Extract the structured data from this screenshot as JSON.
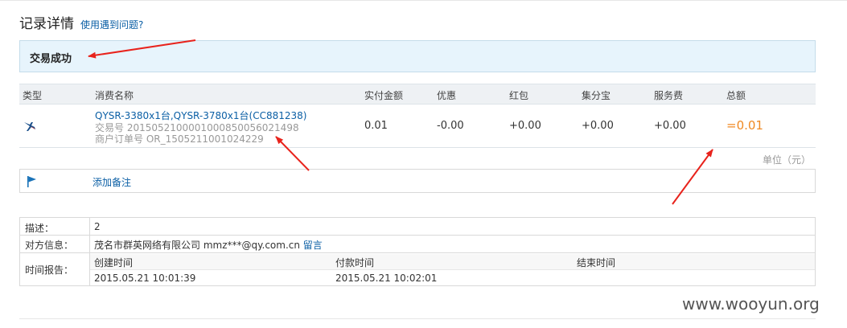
{
  "header": {
    "title": "记录详情",
    "help_link": "使用遇到问题?"
  },
  "status": {
    "text": "交易成功"
  },
  "table": {
    "columns": [
      "类型",
      "消费名称",
      "实付金额",
      "优惠",
      "红包",
      "集分宝",
      "服务费",
      "总额"
    ],
    "row": {
      "type_icon": "bird-icon",
      "name": "QYSR-3380x1台,QYSR-3780x1台(CC881238)",
      "trade_no": "交易号 2015052100001000850056021498",
      "order_no": "商户订单号 OR_1505211001024229",
      "paid": "0.01",
      "discount": "-0.00",
      "red_packet": "+0.00",
      "jifenbao": "+0.00",
      "service_fee": "+0.00",
      "total": "=0.01"
    },
    "unit": "单位（元）"
  },
  "note": {
    "icon": "flag-icon",
    "label": "添加备注"
  },
  "info": {
    "desc_label": "描述：",
    "desc_value": "2",
    "party_label": "对方信息：",
    "party_name": "茂名市群英网络有限公司 mmz***@qy.com.cn",
    "party_msg": "留言",
    "time_label": "时间报告：",
    "time_headers": [
      "创建时间",
      "付款时间",
      "结束时间"
    ],
    "time_values": [
      "2015.05.21 10:01:39",
      "2015.05.21 10:02:01",
      ""
    ]
  },
  "watermark": "www.wooyun.org",
  "colors": {
    "link": "#0b5fa5",
    "status_bg": "#e7f4fc",
    "total": "#f08a24",
    "arrow": "#e8231c"
  }
}
